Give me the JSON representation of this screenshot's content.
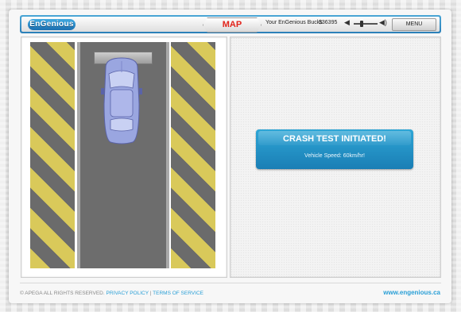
{
  "header": {
    "logo_text": "EnGenious",
    "map_label": "MAP",
    "bucks_label": "Your EnGenious Bucks",
    "bucks_value": "$36395",
    "menu_label": "MENU",
    "accent_color": "#2a9fd6",
    "map_color": "#e2231a"
  },
  "scene": {
    "hazard_colors": [
      "#d9c95a",
      "#6b6b6b"
    ],
    "car_color": "#9aa6e0"
  },
  "status": {
    "title": "CRASH TEST INITIATED!",
    "speed_text": "Vehicle Speed: 60km/hr!"
  },
  "footer": {
    "copyright": "© APEGA ALL RIGHTS RESERVED.",
    "privacy_link": "PRIVACY POLICY",
    "divider": "|",
    "terms_link": "TERMS OF SERVICE",
    "site": "www.engenious.ca"
  }
}
